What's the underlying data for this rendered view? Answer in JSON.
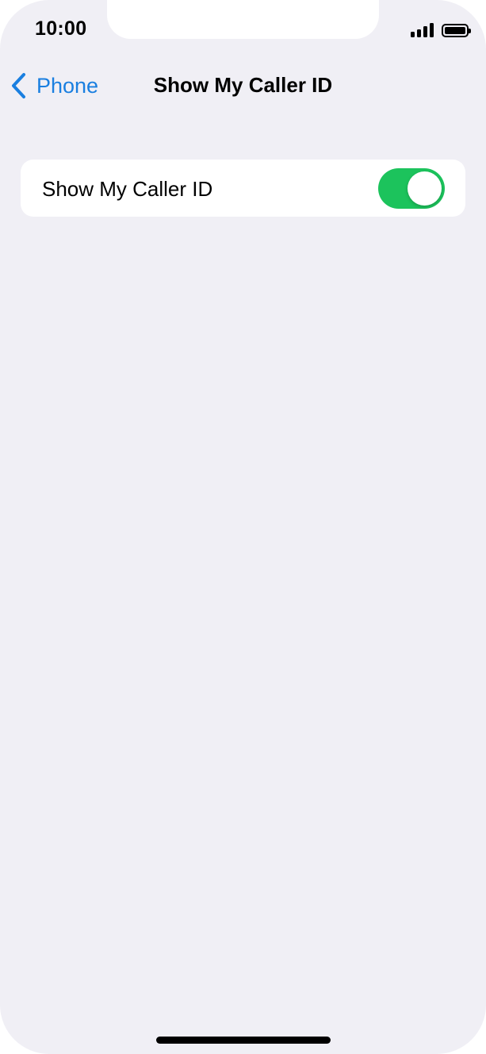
{
  "status_bar": {
    "time": "10:00",
    "signal_icon": "cellular-signal-icon",
    "battery_icon": "battery-icon",
    "battery_level": 1.0
  },
  "nav": {
    "back_label": "Phone",
    "back_icon": "chevron-left-icon",
    "title": "Show My Caller ID"
  },
  "settings": {
    "caller_id_row": {
      "label": "Show My Caller ID",
      "enabled": true
    }
  },
  "colors": {
    "accent": "#1a7fe0",
    "toggle_on": "#1cc35c",
    "background": "#f0eff5"
  }
}
